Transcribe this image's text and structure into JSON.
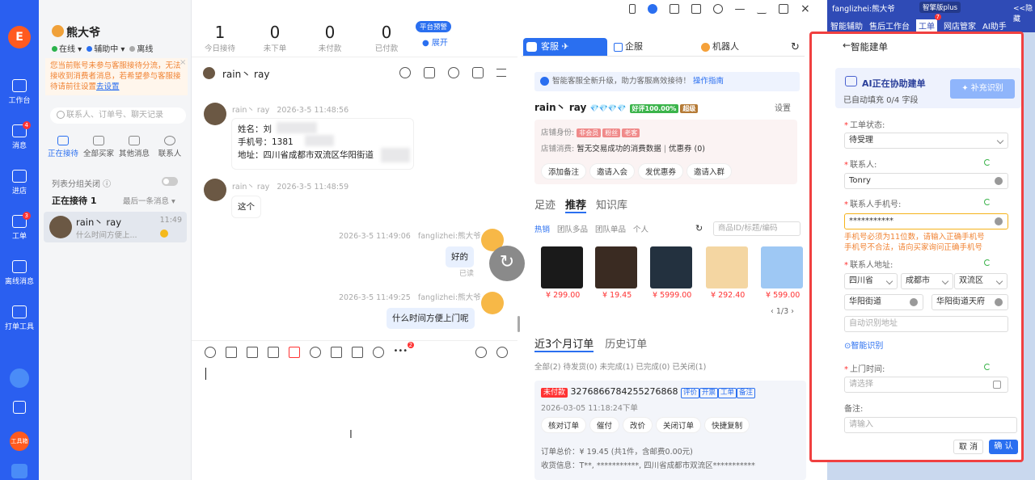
{
  "sidebar": {
    "items": [
      {
        "label": "工作台"
      },
      {
        "label": "消息",
        "badge": "4"
      },
      {
        "label": "进店"
      },
      {
        "label": "工单",
        "badge": "3"
      },
      {
        "label": "离线消息"
      },
      {
        "label": "打单工具"
      }
    ],
    "tool_label": "工具箱"
  },
  "agent": {
    "name": "熊大爷",
    "status_online": "在线",
    "status_assist": "辅助中",
    "status_offline": "离线"
  },
  "stats": [
    {
      "value": "1",
      "label": "今日接待"
    },
    {
      "value": "0",
      "label": "未下单"
    },
    {
      "value": "0",
      "label": "未付款"
    },
    {
      "value": "0",
      "label": "已付款"
    }
  ],
  "platform": {
    "badge": "平台预警",
    "expand": "展开"
  },
  "notice": {
    "text": "您当前账号未参与客服接待分流，无法接收到消费者消息，若希望参与客服接待请前往设置",
    "link": "去设置"
  },
  "search": {
    "placeholder": "联系人、订单号、聊天记录"
  },
  "list_tabs": [
    "正在接待",
    "全部买家",
    "其他消息",
    "联系人"
  ],
  "list": {
    "group_toggle": "列表分组关闭",
    "receiving": "正在接待 1",
    "sort": "最后一条消息",
    "items": [
      {
        "name": "rain丶 ray",
        "time": "11:49",
        "preview": "什么时间方便上..."
      }
    ]
  },
  "chat": {
    "title": "rain丶 ray",
    "messages": [
      {
        "sender": "rain丶 ray",
        "time": "2026-3-5 11:48:56",
        "lines": [
          "姓名：刘",
          "手机号：1381",
          "地址：四川省成都市双流区华阳街道"
        ]
      },
      {
        "sender": "rain丶 ray",
        "time": "2026-3-5 11:48:59",
        "lines": [
          "这个"
        ]
      },
      {
        "sender": "fanglizhei:熊大爷",
        "time": "2026-3-5 11:49:06",
        "lines": [
          "好的"
        ],
        "read": "已读"
      },
      {
        "sender": "fanglizhei:熊大爷",
        "time": "2026-3-5 11:49:25",
        "lines": [
          "什么时间方便上门呢"
        ]
      }
    ],
    "tool_badge": "2"
  },
  "mid": {
    "tabs": [
      "客服",
      "企服",
      "机器人"
    ],
    "info": "智能客服全新升级，助力客服高效接待！",
    "info_link": "操作指南",
    "customer": "rain丶 ray",
    "praise": "好评100.00%",
    "level": "超级",
    "settings": "设置",
    "shop_identity_label": "店铺身份:",
    "identity_tags": [
      "非会员",
      "粉丝",
      "老客"
    ],
    "shop_consume_label": "店铺消费:",
    "shop_consume": "暂无交易成功的消费数据",
    "coupon": "优惠券 (0)",
    "actions": [
      "添加备注",
      "邀请入会",
      "发优惠券",
      "邀请入群"
    ],
    "sections": [
      "足迹",
      "推荐",
      "知识库"
    ],
    "prod_tabs": [
      "热销",
      "团队多品",
      "团队单品",
      "个人"
    ],
    "prod_search": "商品ID/标题/编码",
    "prices": [
      "¥ 299.00",
      "¥ 19.45",
      "¥ 5999.00",
      "¥ 292.40",
      "¥ 599.00"
    ],
    "pager": "1/3",
    "orders_title": "近3个月订单",
    "orders_history": "历史订单",
    "order_filters": "全部(2)  待发货(0)  未完成(1)  已完成(0)  已关闭(1)",
    "order": {
      "status": "未付款",
      "id": "3276866784255276868",
      "tags": [
        "评价",
        "开票",
        "工单",
        "备注"
      ],
      "time": "2026-03-05 11:18:24下单",
      "actions": [
        "核对订单",
        "催付",
        "改价",
        "关闭订单",
        "快捷复制"
      ],
      "total": "订单总价：¥ 19.45 (共1件，含邮费0.00元)",
      "addr": "收货信息：T**, ***********, 四川省成都市双流区***********"
    }
  },
  "farright": {
    "user": "fanglizhei:熊大爷",
    "plan": "智擎版plus",
    "tabs": [
      "智能辅助",
      "售后工作台",
      "工单",
      "网店管家",
      "AI助手"
    ],
    "tab_badge": "7",
    "collapse": "<<隐藏"
  },
  "form": {
    "title": "智能建单",
    "ai_title": "AI正在协助建单",
    "ai_sub": "已自动填充 0/4 字段",
    "ai_btn": "补充识别",
    "status_label": "工单状态:",
    "status_value": "待受理",
    "contact_label": "联系人:",
    "contact_value": "Tonry",
    "phone_label": "联系人手机号:",
    "phone_value": "***********",
    "phone_error1": "手机号必须为11位数，请输入正确手机号",
    "phone_error2": "手机号不合法，请向买家询问正确手机号",
    "addr_label": "联系人地址:",
    "province": "四川省",
    "city": "成都市",
    "district": "双流区",
    "street": "华阳街道",
    "street2": "华阳街道天府",
    "auto_addr": "自动识别地址",
    "smart_recognize": "智能识别",
    "visit_label": "上门时间:",
    "visit_placeholder": "请选择",
    "remark_label": "备注:",
    "remark_placeholder": "请输入",
    "cancel": "取 消",
    "confirm": "确 认"
  },
  "colors": {
    "brand": "#2a5ff0",
    "accent": "#2a6ff0",
    "highlight": "#f04040",
    "warn": "#f08232"
  }
}
